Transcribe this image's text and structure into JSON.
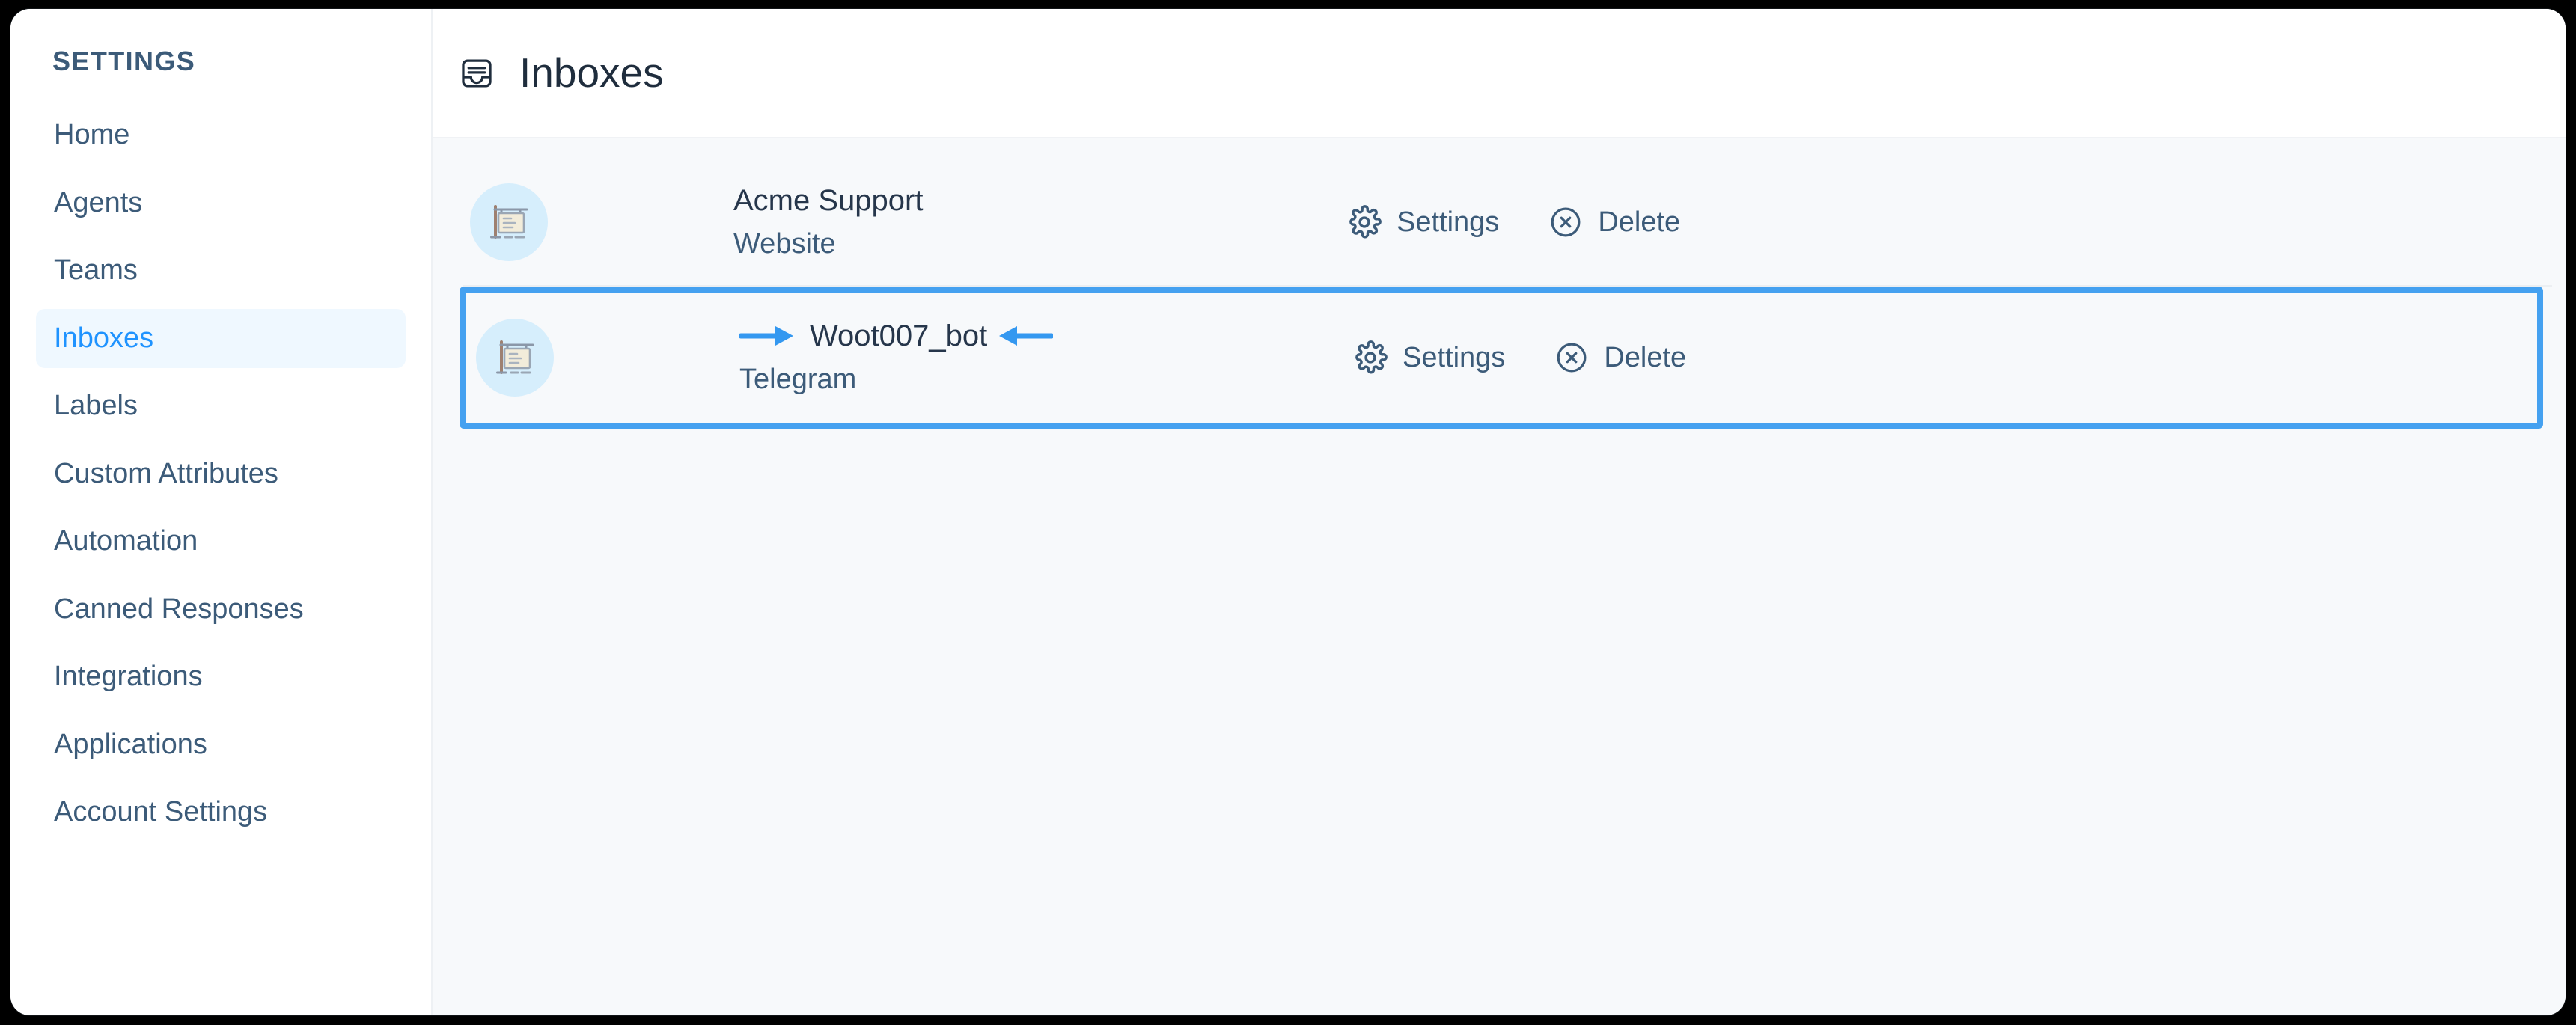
{
  "window": {
    "frame_color": "#111417",
    "background": "#000000"
  },
  "sidebar": {
    "heading": "SETTINGS",
    "active_item": "Inboxes",
    "active_text_color": "#1f93ff",
    "active_bg_color": "#eff8ff",
    "text_color": "#3c5b79",
    "items": [
      {
        "label": "Home"
      },
      {
        "label": "Agents"
      },
      {
        "label": "Teams"
      },
      {
        "label": "Inboxes"
      },
      {
        "label": "Labels"
      },
      {
        "label": "Custom Attributes"
      },
      {
        "label": "Automation"
      },
      {
        "label": "Canned Responses"
      },
      {
        "label": "Integrations"
      },
      {
        "label": "Applications"
      },
      {
        "label": "Account Settings"
      }
    ]
  },
  "header": {
    "title": "Inboxes",
    "icon": "inbox-icon",
    "title_color": "#1f2d3d"
  },
  "main": {
    "background": "#f7f9fb",
    "highlight_color": "#45a1f0",
    "annotation_arrow_color": "#3498f0",
    "rows": [
      {
        "avatar_icon": "signboard-icon",
        "name": "Acme Support",
        "channel": "Website",
        "highlighted": false,
        "annotated": false,
        "actions": [
          {
            "icon": "gear-icon",
            "label": "Settings"
          },
          {
            "icon": "circle-x-icon",
            "label": "Delete"
          }
        ]
      },
      {
        "avatar_icon": "signboard-icon",
        "name": "Woot007_bot",
        "channel": "Telegram",
        "highlighted": true,
        "annotated": true,
        "actions": [
          {
            "icon": "gear-icon",
            "label": "Settings"
          },
          {
            "icon": "circle-x-icon",
            "label": "Delete"
          }
        ]
      }
    ]
  }
}
